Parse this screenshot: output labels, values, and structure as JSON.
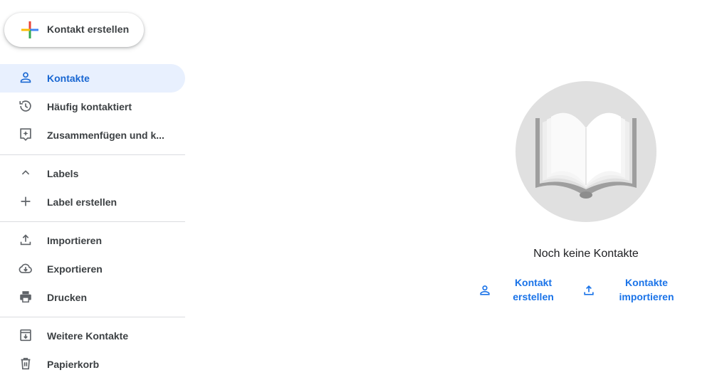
{
  "sidebar": {
    "create_button": {
      "label": "Kontakt erstellen",
      "icon": "plus-multicolor-icon"
    },
    "items": [
      {
        "label": "Kontakte",
        "icon": "person-icon",
        "active": true
      },
      {
        "label": "Häufig kontaktiert",
        "icon": "history-icon"
      },
      {
        "label": "Zusammenfügen und k...",
        "icon": "merge-sparkle-icon"
      },
      {
        "label": "Labels",
        "icon": "chevron-up-icon"
      },
      {
        "label": "Label erstellen",
        "icon": "plus-icon"
      },
      {
        "label": "Importieren",
        "icon": "upload-icon"
      },
      {
        "label": "Exportieren",
        "icon": "cloud-download-icon"
      },
      {
        "label": "Drucken",
        "icon": "printer-icon"
      },
      {
        "label": "Weitere Kontakte",
        "icon": "archive-download-icon"
      },
      {
        "label": "Papierkorb",
        "icon": "trash-icon"
      }
    ]
  },
  "main": {
    "empty_state": {
      "illustration": "open-book-icon",
      "message": "Noch keine Kontakte"
    },
    "actions": [
      {
        "line1": "Kontakt",
        "line2": "erstellen",
        "icon": "person-icon"
      },
      {
        "line1": "Kontakte",
        "line2": "importieren",
        "icon": "upload-icon"
      }
    ]
  },
  "colors": {
    "accent": "#1a73e8",
    "active_bg": "#e8f0fe",
    "text": "#3c4043",
    "divider": "#dadce0",
    "illustration_bg": "#e0e0e0"
  }
}
